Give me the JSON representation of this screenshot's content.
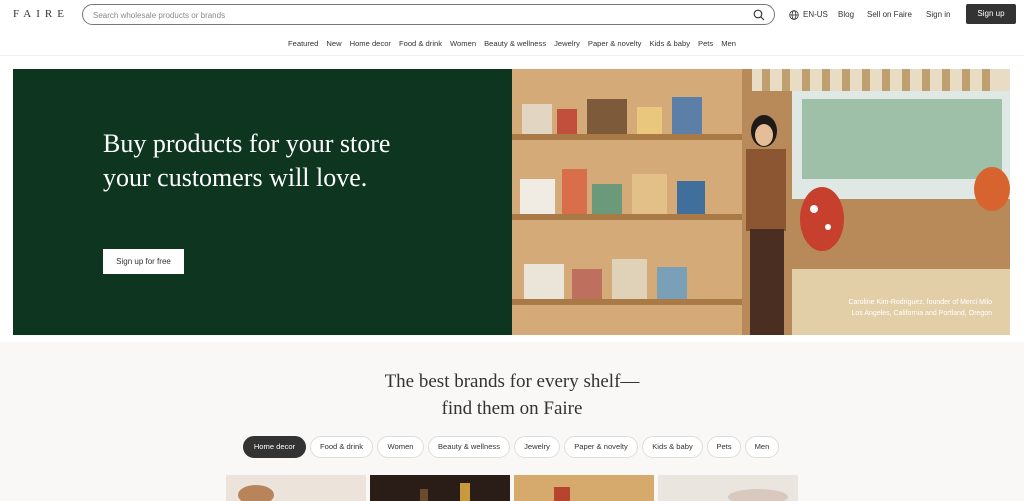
{
  "header": {
    "logo": "FAIRE",
    "search_placeholder": "Search wholesale products or brands",
    "language": "EN-US",
    "blog": "Blog",
    "sell": "Sell on Faire",
    "signin": "Sign in",
    "signup": "Sign up"
  },
  "categories": [
    "Featured",
    "New",
    "Home decor",
    "Food & drink",
    "Women",
    "Beauty & wellness",
    "Jewelry",
    "Paper & novelty",
    "Kids & baby",
    "Pets",
    "Men"
  ],
  "hero": {
    "title": "Buy products for your store your customers will love.",
    "button": "Sign up for free",
    "caption_line1": "Caroline Kim-Rodriguez, founder of Merci Milo",
    "caption_line2": "Los Angeles, California and Portland, Oregon",
    "bg_color": "#0d351f"
  },
  "brands_section": {
    "title_line1": "The best brands for every shelf—",
    "title_line2": "find them on Faire",
    "pills": [
      "Home decor",
      "Food & drink",
      "Women",
      "Beauty & wellness",
      "Jewelry",
      "Paper & novelty",
      "Kids & baby",
      "Pets",
      "Men"
    ],
    "active_pill": "Home decor"
  }
}
